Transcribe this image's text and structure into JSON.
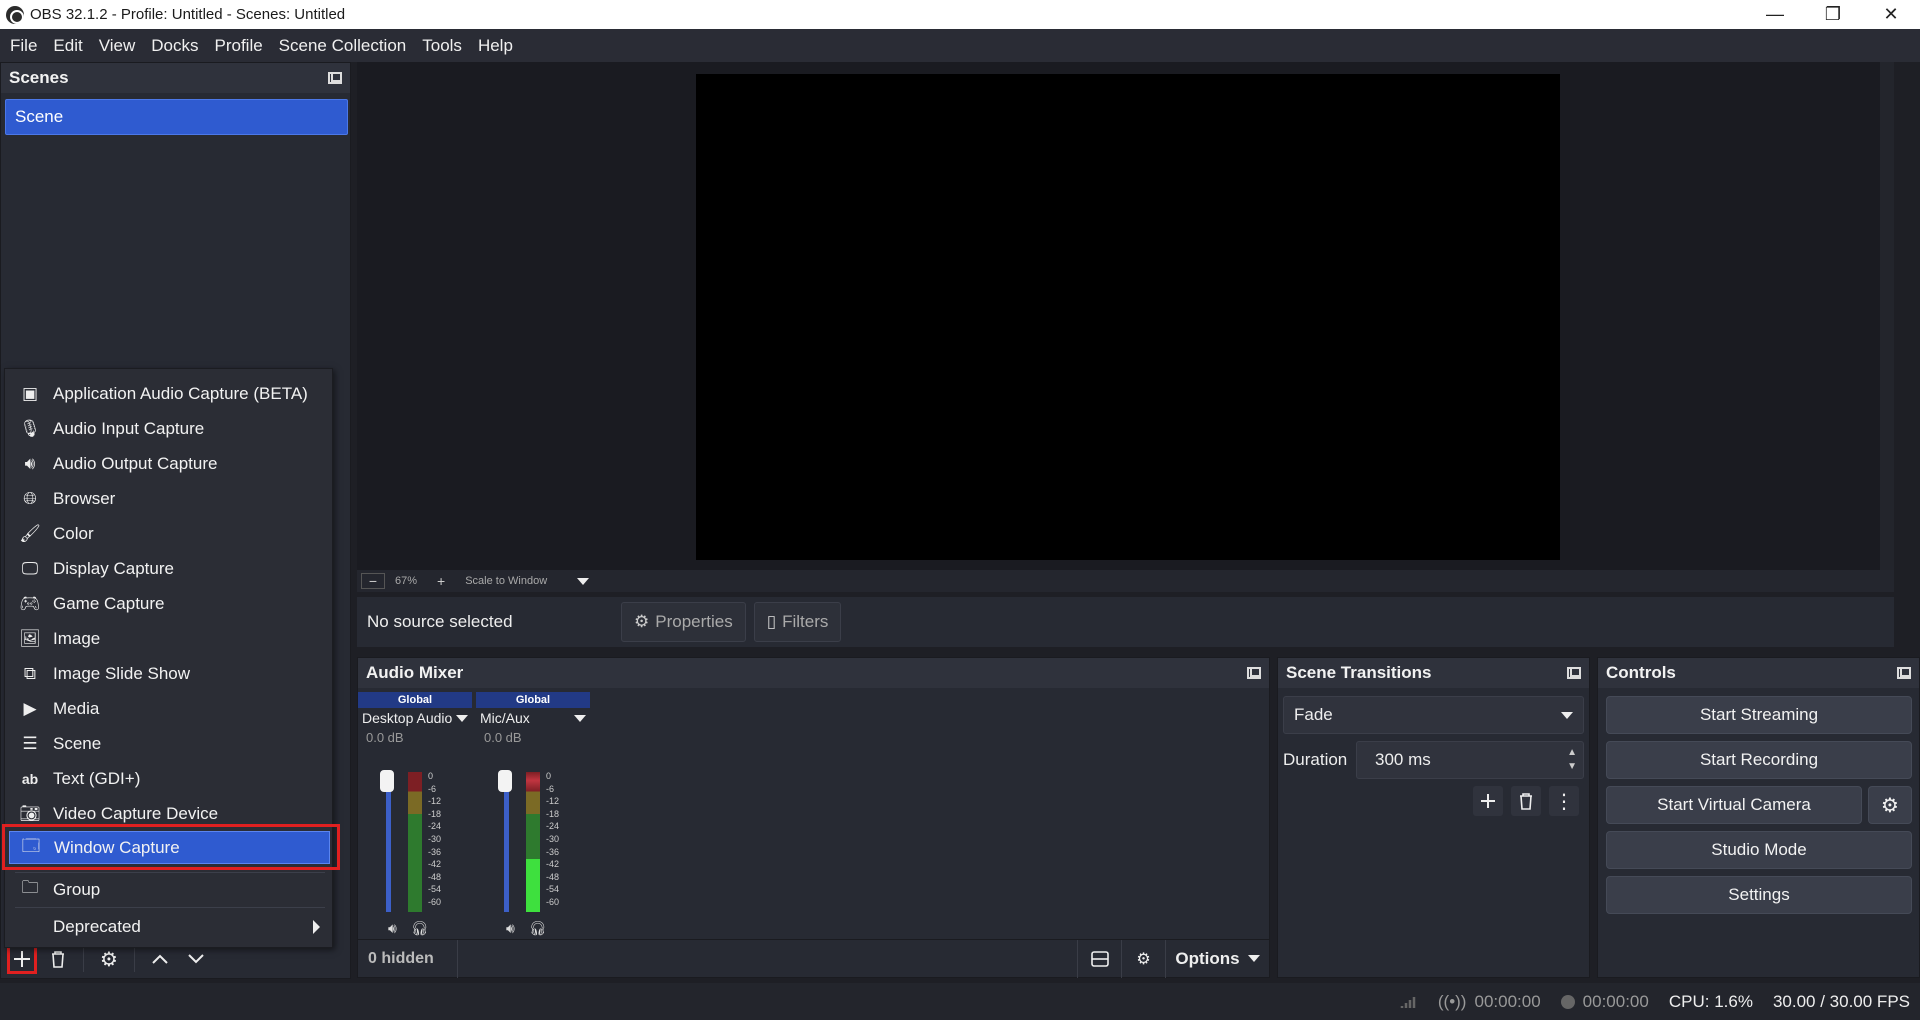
{
  "window": {
    "title": "OBS 32.1.2 - Profile: Untitled - Scenes: Untitled",
    "minimize": "—",
    "restore": "❐",
    "close": "✕"
  },
  "menubar": [
    "File",
    "Edit",
    "View",
    "Docks",
    "Profile",
    "Scene Collection",
    "Tools",
    "Help"
  ],
  "scenes": {
    "title": "Scenes",
    "items": [
      "Scene"
    ]
  },
  "preview": {
    "zoom": "67%",
    "scale_mode": "Scale to Window"
  },
  "source_bar": {
    "status": "No source selected",
    "properties_label": "Properties",
    "filters_label": "Filters"
  },
  "audio_mixer": {
    "title": "Audio Mixer",
    "channels": [
      {
        "badge": "Global",
        "name": "Desktop Audio",
        "db": "0.0 dB",
        "level": 0
      },
      {
        "badge": "Global",
        "name": "Mic/Aux",
        "db": "0.0 dB",
        "level": 0.38
      }
    ],
    "scale": [
      "0",
      "-6",
      "-12",
      "-18",
      "-24",
      "-30",
      "-36",
      "-42",
      "-48",
      "-54",
      "-60"
    ],
    "hidden_label": "0 hidden",
    "options_label": "Options"
  },
  "scene_transitions": {
    "title": "Scene Transitions",
    "transition": "Fade",
    "duration_label": "Duration",
    "duration_value": "300 ms"
  },
  "controls": {
    "title": "Controls",
    "start_streaming": "Start Streaming",
    "start_recording": "Start Recording",
    "start_virtual_camera": "Start Virtual Camera",
    "studio_mode": "Studio Mode",
    "settings": "Settings"
  },
  "statusbar": {
    "stream_time": "00:00:00",
    "record_time": "00:00:00",
    "cpu": "CPU: 1.6%",
    "fps": "30.00 / 30.00 FPS"
  },
  "context_menu": {
    "items": [
      {
        "label": "Application Audio Capture (BETA)",
        "icon": "app-audio-icon"
      },
      {
        "label": "Audio Input Capture",
        "icon": "microphone-icon"
      },
      {
        "label": "Audio Output Capture",
        "icon": "speaker-icon"
      },
      {
        "label": "Browser",
        "icon": "globe-icon"
      },
      {
        "label": "Color",
        "icon": "brush-icon"
      },
      {
        "label": "Display Capture",
        "icon": "monitor-icon"
      },
      {
        "label": "Game Capture",
        "icon": "gamepad-icon"
      },
      {
        "label": "Image",
        "icon": "image-icon"
      },
      {
        "label": "Image Slide Show",
        "icon": "slideshow-icon"
      },
      {
        "label": "Media",
        "icon": "play-icon"
      },
      {
        "label": "Scene",
        "icon": "list-icon"
      },
      {
        "label": "Text (GDI+)",
        "icon": "text-icon"
      },
      {
        "label": "Video Capture Device",
        "icon": "camera-icon"
      },
      {
        "label": "Window Capture",
        "icon": "window-icon"
      }
    ],
    "group": "Group",
    "deprecated": "Deprecated"
  }
}
